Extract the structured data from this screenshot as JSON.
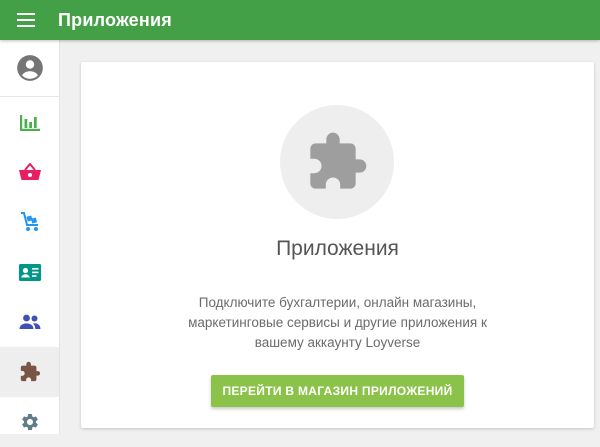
{
  "header": {
    "title": "Приложения",
    "menu_icon": "menu-icon",
    "bg_color": "#43a047"
  },
  "sidebar": {
    "items": [
      {
        "id": "account",
        "icon": "account-circle-icon",
        "color": "#757575"
      },
      {
        "id": "reports",
        "icon": "bar-chart-icon",
        "color": "#4caf50"
      },
      {
        "id": "items",
        "icon": "basket-icon",
        "color": "#e91e63"
      },
      {
        "id": "inventory",
        "icon": "cart-icon",
        "color": "#2196f3"
      },
      {
        "id": "customers",
        "icon": "contact-card-icon",
        "color": "#009688"
      },
      {
        "id": "employees",
        "icon": "people-icon",
        "color": "#3f51b5"
      },
      {
        "id": "apps",
        "icon": "puzzle-icon",
        "color": "#795548",
        "active": true
      },
      {
        "id": "settings",
        "icon": "settings-icon",
        "color": "#607d8b"
      }
    ]
  },
  "card": {
    "icon": "puzzle-icon",
    "title": "Приложения",
    "description_lines": [
      "Подключите бухгалтерии, онлайн магазины,",
      "маркетинговые сервисы и другие приложения к",
      "вашему аккаунту Loyverse"
    ],
    "button_label": "ПЕРЕЙТИ В МАГАЗИН ПРИЛОЖЕНИЙ",
    "button_color": "#8bc34a"
  }
}
